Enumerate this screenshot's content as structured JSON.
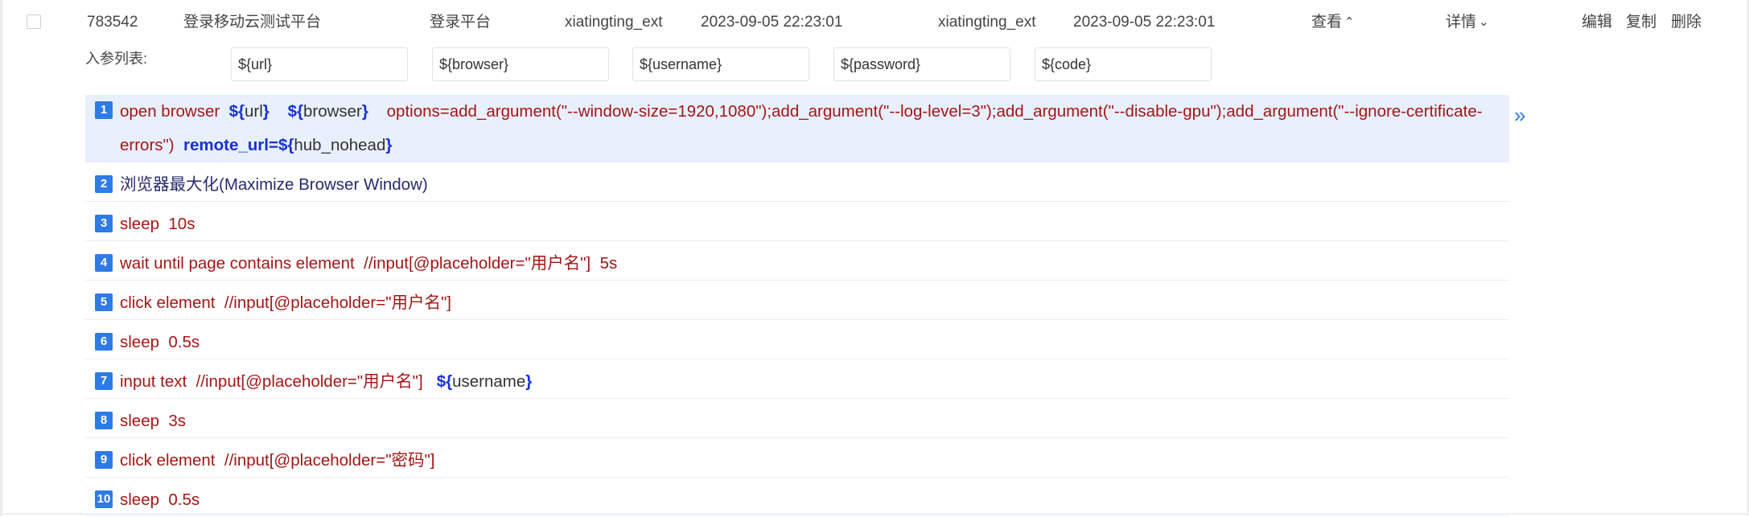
{
  "row": {
    "id": "783542",
    "name": "登录移动云测试平台",
    "platform": "登录平台",
    "creator": "xiatingting_ext",
    "created_at": "2023-09-05 22:23:01",
    "updater": "xiatingting_ext",
    "updated_at": "2023-09-05 22:23:01",
    "view_label": "查看",
    "detail_label": "详情",
    "edit_label": "编辑",
    "copy_label": "复制",
    "delete_label": "删除"
  },
  "params": {
    "label": "入参列表:",
    "values": [
      "${url}",
      "${browser}",
      "${username}",
      "${password}",
      "${code}"
    ]
  },
  "steps": [
    {
      "n": "1",
      "parts": [
        {
          "t": "open browser  "
        },
        {
          "t": "${",
          "k": "kw"
        },
        {
          "t": "url",
          "k": "var"
        },
        {
          "t": "}",
          "k": "kw"
        },
        {
          "t": "    "
        },
        {
          "t": "${",
          "k": "kw"
        },
        {
          "t": "browser",
          "k": "var"
        },
        {
          "t": "}",
          "k": "kw"
        },
        {
          "t": "    options=add_argument(\"--window-size=1920,1080\");add_argument(\"--log-level=3\");add_argument(\"--disable-gpu\");add_argument(\"--ignore-certificate-errors\")  "
        },
        {
          "t": "remote_url=${",
          "k": "kw"
        },
        {
          "t": "hub_nohead",
          "k": "var"
        },
        {
          "t": "}",
          "k": "kw"
        }
      ]
    },
    {
      "n": "2",
      "parts": [
        {
          "t": "浏览器最大化(Maximize Browser Window)",
          "k": "builtin"
        }
      ]
    },
    {
      "n": "3",
      "parts": [
        {
          "t": "sleep  10s"
        }
      ]
    },
    {
      "n": "4",
      "parts": [
        {
          "t": "wait until page contains element  //input[@placeholder=\"用户名\"]  5s"
        }
      ]
    },
    {
      "n": "5",
      "parts": [
        {
          "t": "click element  //input[@placeholder=\"用户名\"]"
        }
      ]
    },
    {
      "n": "6",
      "parts": [
        {
          "t": "sleep  0.5s"
        }
      ]
    },
    {
      "n": "7",
      "parts": [
        {
          "t": "input text  //input[@placeholder=\"用户名\"]   "
        },
        {
          "t": "${",
          "k": "kw"
        },
        {
          "t": "username",
          "k": "var"
        },
        {
          "t": "}",
          "k": "kw"
        }
      ]
    },
    {
      "n": "8",
      "parts": [
        {
          "t": "sleep  3s"
        }
      ]
    },
    {
      "n": "9",
      "parts": [
        {
          "t": "click element  //input[@placeholder=\"密码\"]"
        }
      ]
    },
    {
      "n": "10",
      "parts": [
        {
          "t": "sleep  0.5s"
        }
      ]
    }
  ],
  "icons": {
    "expand": "double-chevron-right-icon",
    "view_chevron": "chevron-up-icon",
    "detail_chevron": "chevron-down-icon"
  },
  "colors": {
    "accent": "#2d7be5",
    "keyword": "#1730d8",
    "text_red": "#a31616",
    "active_row": "#e8f0fe"
  }
}
